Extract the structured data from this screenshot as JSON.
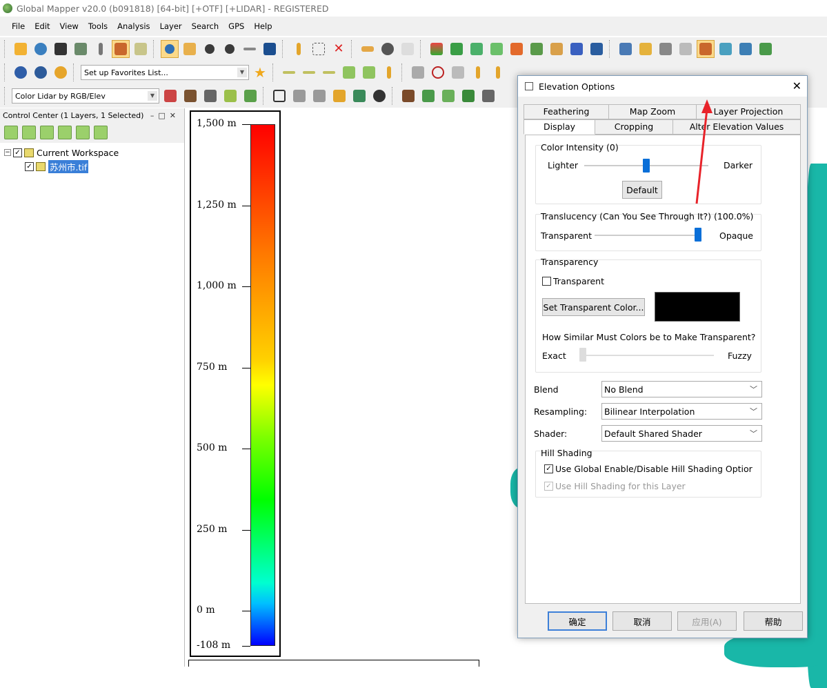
{
  "window": {
    "title": "Global Mapper v20.0 (b091818) [64-bit] [+OTF] [+LIDAR] - REGISTERED"
  },
  "menu": [
    "File",
    "Edit",
    "View",
    "Tools",
    "Analysis",
    "Layer",
    "Search",
    "GPS",
    "Help"
  ],
  "toolbar": {
    "favorites_placeholder": "Set up Favorites List...",
    "color_mode": "Color Lidar by RGB/Elev"
  },
  "control_center": {
    "title": "Control Center (1 Layers, 1 Selected)",
    "workspace": "Current Workspace",
    "layer": "苏州市.tif"
  },
  "legend": {
    "ticks": [
      "1,500 m",
      "1,250 m",
      "1,000 m",
      "750 m",
      "500 m",
      "250 m",
      "0 m",
      "-108 m"
    ],
    "values": [
      1500,
      1250,
      1000,
      750,
      500,
      250,
      0,
      -108
    ],
    "colors": {
      "top": "#ff0000",
      "bottom": "#0000ff"
    }
  },
  "dialog": {
    "title": "Elevation Options",
    "tabs_row1": [
      "Feathering",
      "Map Zoom",
      "Layer Projection"
    ],
    "tabs_row2": [
      "Display",
      "Cropping",
      "Alter Elevation Values"
    ],
    "active_tab": "Display",
    "color_intensity": {
      "label": "Color Intensity (0)",
      "left": "Lighter",
      "right": "Darker",
      "default_btn": "Default",
      "value": 0.5
    },
    "translucency": {
      "label": "Translucency (Can You See Through It?) (100.0%)",
      "left": "Transparent",
      "right": "Opaque",
      "value": 1.0
    },
    "transparency": {
      "group": "Transparency",
      "checkbox": "Transparent",
      "set_color_btn": "Set Transparent Color...",
      "swatch": "#000000",
      "similar_label": "How Similar Must Colors be to Make Transparent?",
      "left": "Exact",
      "right": "Fuzzy",
      "value": 0.0
    },
    "blend": {
      "label": "Blend",
      "value": "No Blend"
    },
    "resampling": {
      "label": "Resampling:",
      "value": "Bilinear Interpolation"
    },
    "shader": {
      "label": "Shader:",
      "value": "Default Shared Shader"
    },
    "hill": {
      "group": "Hill Shading",
      "global": "Use Global Enable/Disable Hill Shading Optior",
      "layer": "Use Hill Shading for this Layer"
    },
    "buttons": {
      "ok": "确定",
      "cancel": "取消",
      "apply": "应用(A)",
      "help": "帮助"
    }
  },
  "annotation": {
    "arrow_color": "#e8232a"
  }
}
